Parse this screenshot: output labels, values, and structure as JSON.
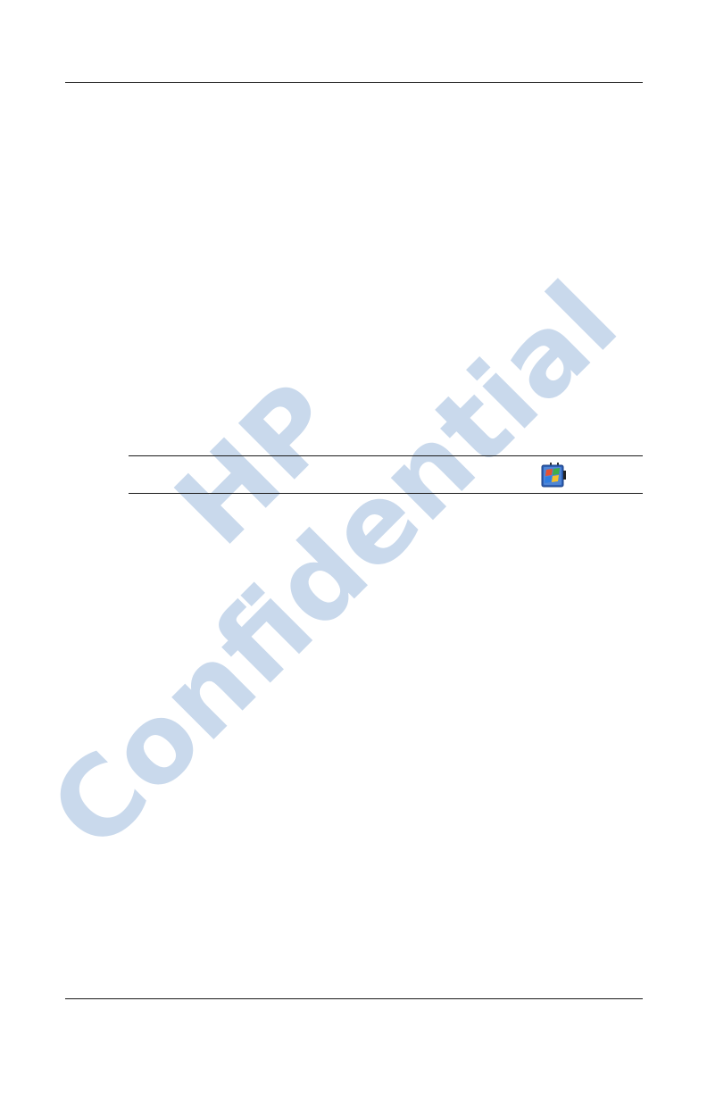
{
  "watermark": {
    "line1": "HP",
    "line2": "Confidential",
    "color": "#c9d9ec"
  },
  "note": {
    "icon": "windows-start-icon"
  }
}
